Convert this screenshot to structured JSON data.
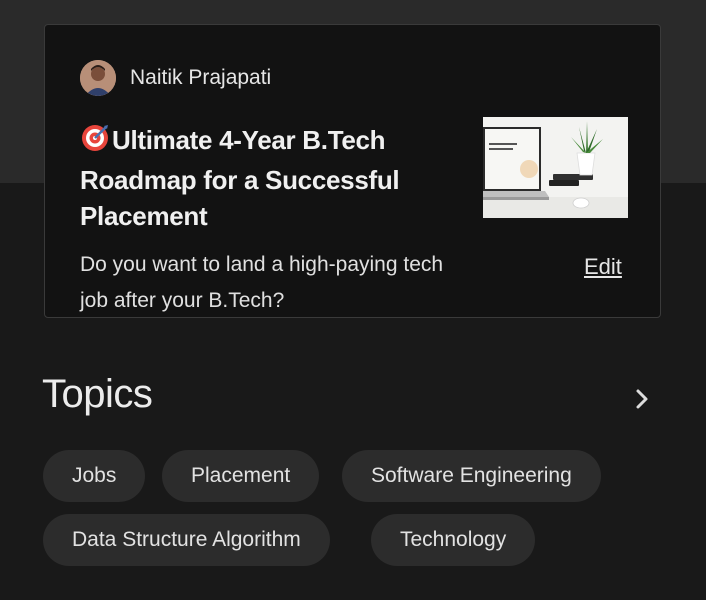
{
  "story_card": {
    "author_name": "Naitik Prajapati",
    "title_emoji": "target-icon",
    "title": "Ultimate 4-Year B.Tech Roadmap for a Successful Placement",
    "excerpt": "Do you want to land a high-paying tech job after your B.Tech?",
    "edit_label": "Edit"
  },
  "topics": {
    "heading": "Topics",
    "chips": [
      {
        "label": "Jobs"
      },
      {
        "label": "Placement"
      },
      {
        "label": "Software Engineering"
      },
      {
        "label": "Data Structure Algorithm"
      },
      {
        "label": "Technology"
      }
    ]
  },
  "colors": {
    "background": "#191919",
    "top_band": "#2a2a2a",
    "card": "#121212",
    "chip": "#2c2c2c",
    "text": "#e6e6e6"
  }
}
